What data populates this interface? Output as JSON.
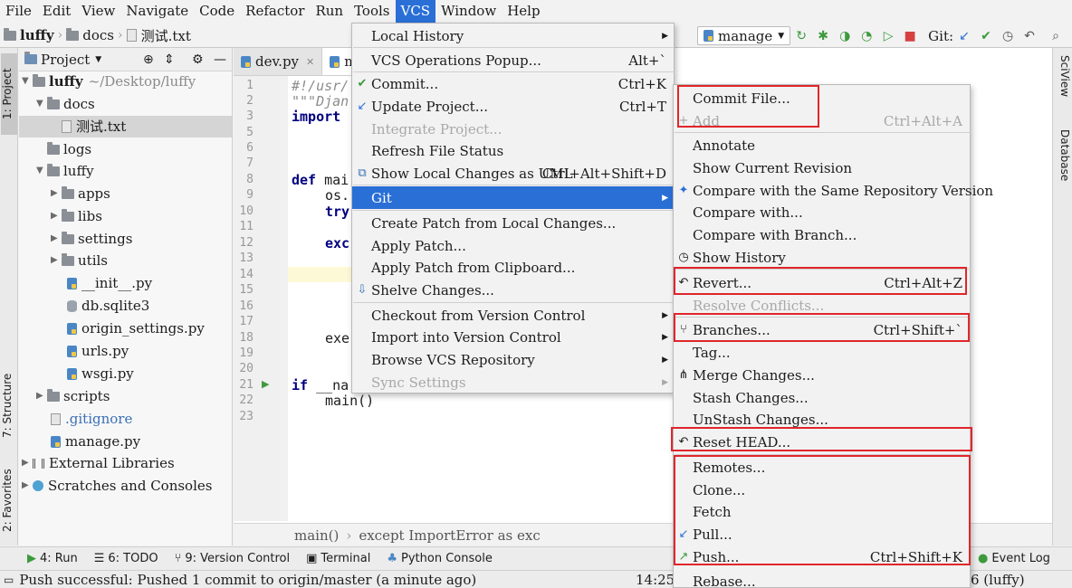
{
  "menubar": {
    "items": [
      "File",
      "Edit",
      "View",
      "Navigate",
      "Code",
      "Refactor",
      "Run",
      "Tools",
      "VCS",
      "Window",
      "Help"
    ]
  },
  "navbar": {
    "crumbs": [
      "luffy",
      "docs",
      "测试.txt"
    ],
    "run_config": "manage",
    "git_label": "Git:"
  },
  "left_strip": {
    "project_tab": "1: Project",
    "structure_tab": "7: Structure",
    "favorites_tab": "2: Favorites"
  },
  "right_strip": {
    "sciview_tab": "SciView",
    "database_tab": "Database"
  },
  "project": {
    "header": "Project",
    "tree": [
      {
        "label": "luffy",
        "path": "~/Desktop/luffy"
      },
      {
        "label": "docs"
      },
      {
        "label": "测试.txt"
      },
      {
        "label": "logs"
      },
      {
        "label": "luffy"
      },
      {
        "label": "apps"
      },
      {
        "label": "libs"
      },
      {
        "label": "settings"
      },
      {
        "label": "utils"
      },
      {
        "label": "__init__.py"
      },
      {
        "label": "db.sqlite3"
      },
      {
        "label": "origin_settings.py"
      },
      {
        "label": "urls.py"
      },
      {
        "label": "wsgi.py"
      },
      {
        "label": "scripts"
      },
      {
        "label": ".gitignore"
      },
      {
        "label": "manage.py"
      },
      {
        "label": "External Libraries"
      },
      {
        "label": "Scratches and Consoles"
      }
    ]
  },
  "editor": {
    "tabs": [
      "dev.py",
      "m"
    ],
    "line_numbers": [
      "1",
      "2",
      "3",
      "5",
      "6",
      "7",
      "8",
      "9",
      "10",
      "11",
      "12",
      "13",
      "14",
      "15",
      "16",
      "17",
      "18",
      "19",
      "20",
      "21",
      "22",
      "23"
    ],
    "code": {
      "l1": "#!/usr/",
      "l2": "\"\"\"Djan",
      "l3": "import",
      "l8_kw": "def",
      "l8": " mai",
      "l9": "os.",
      "l10": "try",
      "l12": "exc",
      "l18": "exe",
      "l21_kw": "if",
      "l21": " __na",
      "l22": "main()"
    },
    "breadcrumb": [
      "main()",
      "except ImportError as exc"
    ]
  },
  "vcs_menu": {
    "items": [
      {
        "label": "Local History",
        "submenu": true
      },
      {
        "label": "VCS Operations Popup...",
        "shortcut": "Alt+`"
      },
      {
        "label": "Commit...",
        "shortcut": "Ctrl+K",
        "icon": "check-icon"
      },
      {
        "label": "Update Project...",
        "shortcut": "Ctrl+T",
        "icon": "update-arrow-icon"
      },
      {
        "label": "Integrate Project...",
        "disabled": true
      },
      {
        "label": "Refresh File Status"
      },
      {
        "label": "Show Local Changes as UML",
        "shortcut": "Ctrl+Alt+Shift+D",
        "icon": "uml-icon"
      },
      {
        "label": "Git",
        "submenu": true,
        "highlighted": true
      },
      {
        "label": "Create Patch from Local Changes..."
      },
      {
        "label": "Apply Patch..."
      },
      {
        "label": "Apply Patch from Clipboard..."
      },
      {
        "label": "Shelve Changes...",
        "icon": "shelve-icon"
      },
      {
        "label": "Checkout from Version Control",
        "submenu": true
      },
      {
        "label": "Import into Version Control",
        "submenu": true
      },
      {
        "label": "Browse VCS Repository",
        "submenu": true
      },
      {
        "label": "Sync Settings",
        "submenu": true,
        "disabled": true
      }
    ]
  },
  "git_menu": {
    "items": [
      {
        "label": "Commit File..."
      },
      {
        "label": "Add",
        "shortcut": "Ctrl+Alt+A",
        "disabled": true
      },
      {
        "label": "Annotate"
      },
      {
        "label": "Show Current Revision"
      },
      {
        "label": "Compare with the Same Repository Version",
        "icon": "compare-icon"
      },
      {
        "label": "Compare with..."
      },
      {
        "label": "Compare with Branch..."
      },
      {
        "label": "Show History",
        "icon": "history-icon"
      },
      {
        "label": "Revert...",
        "shortcut": "Ctrl+Alt+Z",
        "icon": "revert-icon"
      },
      {
        "label": "Resolve Conflicts...",
        "disabled": true
      },
      {
        "label": "Branches...",
        "shortcut": "Ctrl+Shift+`",
        "icon": "branch-icon"
      },
      {
        "label": "Tag..."
      },
      {
        "label": "Merge Changes...",
        "icon": "merge-icon"
      },
      {
        "label": "Stash Changes..."
      },
      {
        "label": "UnStash Changes..."
      },
      {
        "label": "Reset HEAD...",
        "icon": "revert-icon"
      },
      {
        "label": "Remotes..."
      },
      {
        "label": "Clone..."
      },
      {
        "label": "Fetch"
      },
      {
        "label": "Pull...",
        "icon": "pull-icon"
      },
      {
        "label": "Push...",
        "shortcut": "Ctrl+Shift+K",
        "icon": "push-icon"
      },
      {
        "label": "Rebase..."
      }
    ]
  },
  "bottom_tools": {
    "run": "4: Run",
    "todo": "6: TODO",
    "vc": "9: Version Control",
    "terminal": "Terminal",
    "console": "Python Console",
    "event_log": "Event Log"
  },
  "status": {
    "message": "Push successful: Pushed 1 commit to origin/master (a minute ago)",
    "time": "14:25",
    "branch": "6 (luffy)"
  },
  "colors": {
    "accent": "#2a6fd6",
    "highlight_box": "#e0262b"
  }
}
